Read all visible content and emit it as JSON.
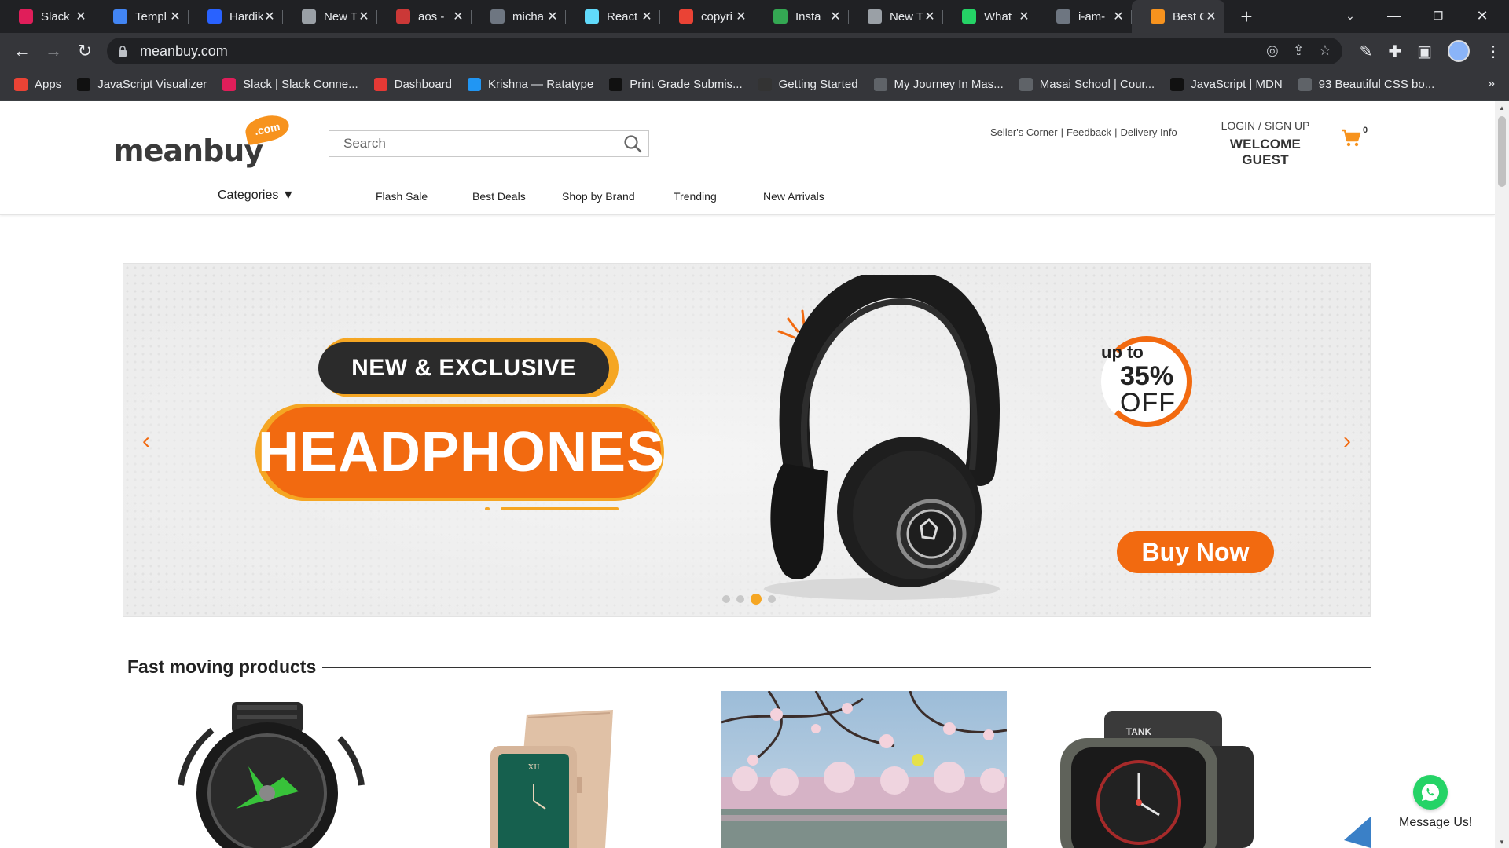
{
  "browser": {
    "tabs": [
      {
        "title": "Slack",
        "icon": "slack-icon",
        "color": "#e01e5a"
      },
      {
        "title": "Templ",
        "icon": "docs-icon",
        "color": "#4285f4"
      },
      {
        "title": "Hardik",
        "icon": "hashnode-icon",
        "color": "#2962ff"
      },
      {
        "title": "New T",
        "icon": "chrome-icon",
        "color": "#9aa0a6"
      },
      {
        "title": "aos - ",
        "icon": "npm-icon",
        "color": "#cb3837"
      },
      {
        "title": "micha",
        "icon": "github-icon",
        "color": "#6e7681"
      },
      {
        "title": "React",
        "icon": "react-icon",
        "color": "#61dafb"
      },
      {
        "title": "copyri",
        "icon": "google-icon",
        "color": "#ea4335"
      },
      {
        "title": "Insta",
        "icon": "sheets-icon",
        "color": "#34a853"
      },
      {
        "title": "New T",
        "icon": "chrome-icon",
        "color": "#9aa0a6"
      },
      {
        "title": "What",
        "icon": "whatsapp-icon",
        "color": "#25d366"
      },
      {
        "title": "i-am-",
        "icon": "github-icon",
        "color": "#6e7681"
      },
      {
        "title": "Best C",
        "icon": "meanbuy-icon",
        "color": "#f7931e",
        "active": true
      }
    ],
    "url": "meanbuy.com",
    "bookmarks": [
      {
        "label": "Apps",
        "icon": "apps-grid-icon",
        "color": "#ea4335"
      },
      {
        "label": "JavaScript Visualizer",
        "icon": "ui-icon",
        "color": "#111111"
      },
      {
        "label": "Slack | Slack Conne...",
        "icon": "slack-icon",
        "color": "#e01e5a"
      },
      {
        "label": "Dashboard",
        "icon": "dashboard-icon",
        "color": "#e53935"
      },
      {
        "label": "Krishna — Ratatype",
        "icon": "ratatype-icon",
        "color": "#2196f3"
      },
      {
        "label": "Print Grade Submis...",
        "icon": "hackerrank-icon",
        "color": "#111111"
      },
      {
        "label": "Getting Started",
        "icon": "notion-icon",
        "color": "#333333"
      },
      {
        "label": "My Journey In Mas...",
        "icon": "globe-icon",
        "color": "#5f6368"
      },
      {
        "label": "Masai School | Cour...",
        "icon": "globe-icon",
        "color": "#5f6368"
      },
      {
        "label": "JavaScript | MDN",
        "icon": "mdn-icon",
        "color": "#111111"
      },
      {
        "label": "93 Beautiful CSS bo...",
        "icon": "css-icon",
        "color": "#5f6368"
      }
    ]
  },
  "site": {
    "logo_text": "meanbuy",
    "logo_badge": ".com",
    "search_placeholder": "Search",
    "top_links": [
      "Seller's Corner",
      "Feedback",
      "Delivery Info"
    ],
    "login_label": "LOGIN",
    "signup_label": "SIGN UP",
    "welcome": "WELCOME GUEST",
    "cart_count": "0",
    "menu": {
      "categories": "Categories ▼",
      "items": [
        "Flash Sale",
        "Best Deals",
        "Shop by Brand",
        "Trending",
        "New Arrivals"
      ]
    },
    "banner": {
      "tagline": "NEW & EXCLUSIVE",
      "headline": "HEADPHONES",
      "offer_prefix": "up to",
      "offer_percent": "35%",
      "offer_suffix": "OFF",
      "cta": "Buy Now",
      "slides_total": 4,
      "slide_active": 3,
      "accent": "#f26a10"
    },
    "section_title": "Fast moving products",
    "whatsapp_label": "Message Us!"
  }
}
